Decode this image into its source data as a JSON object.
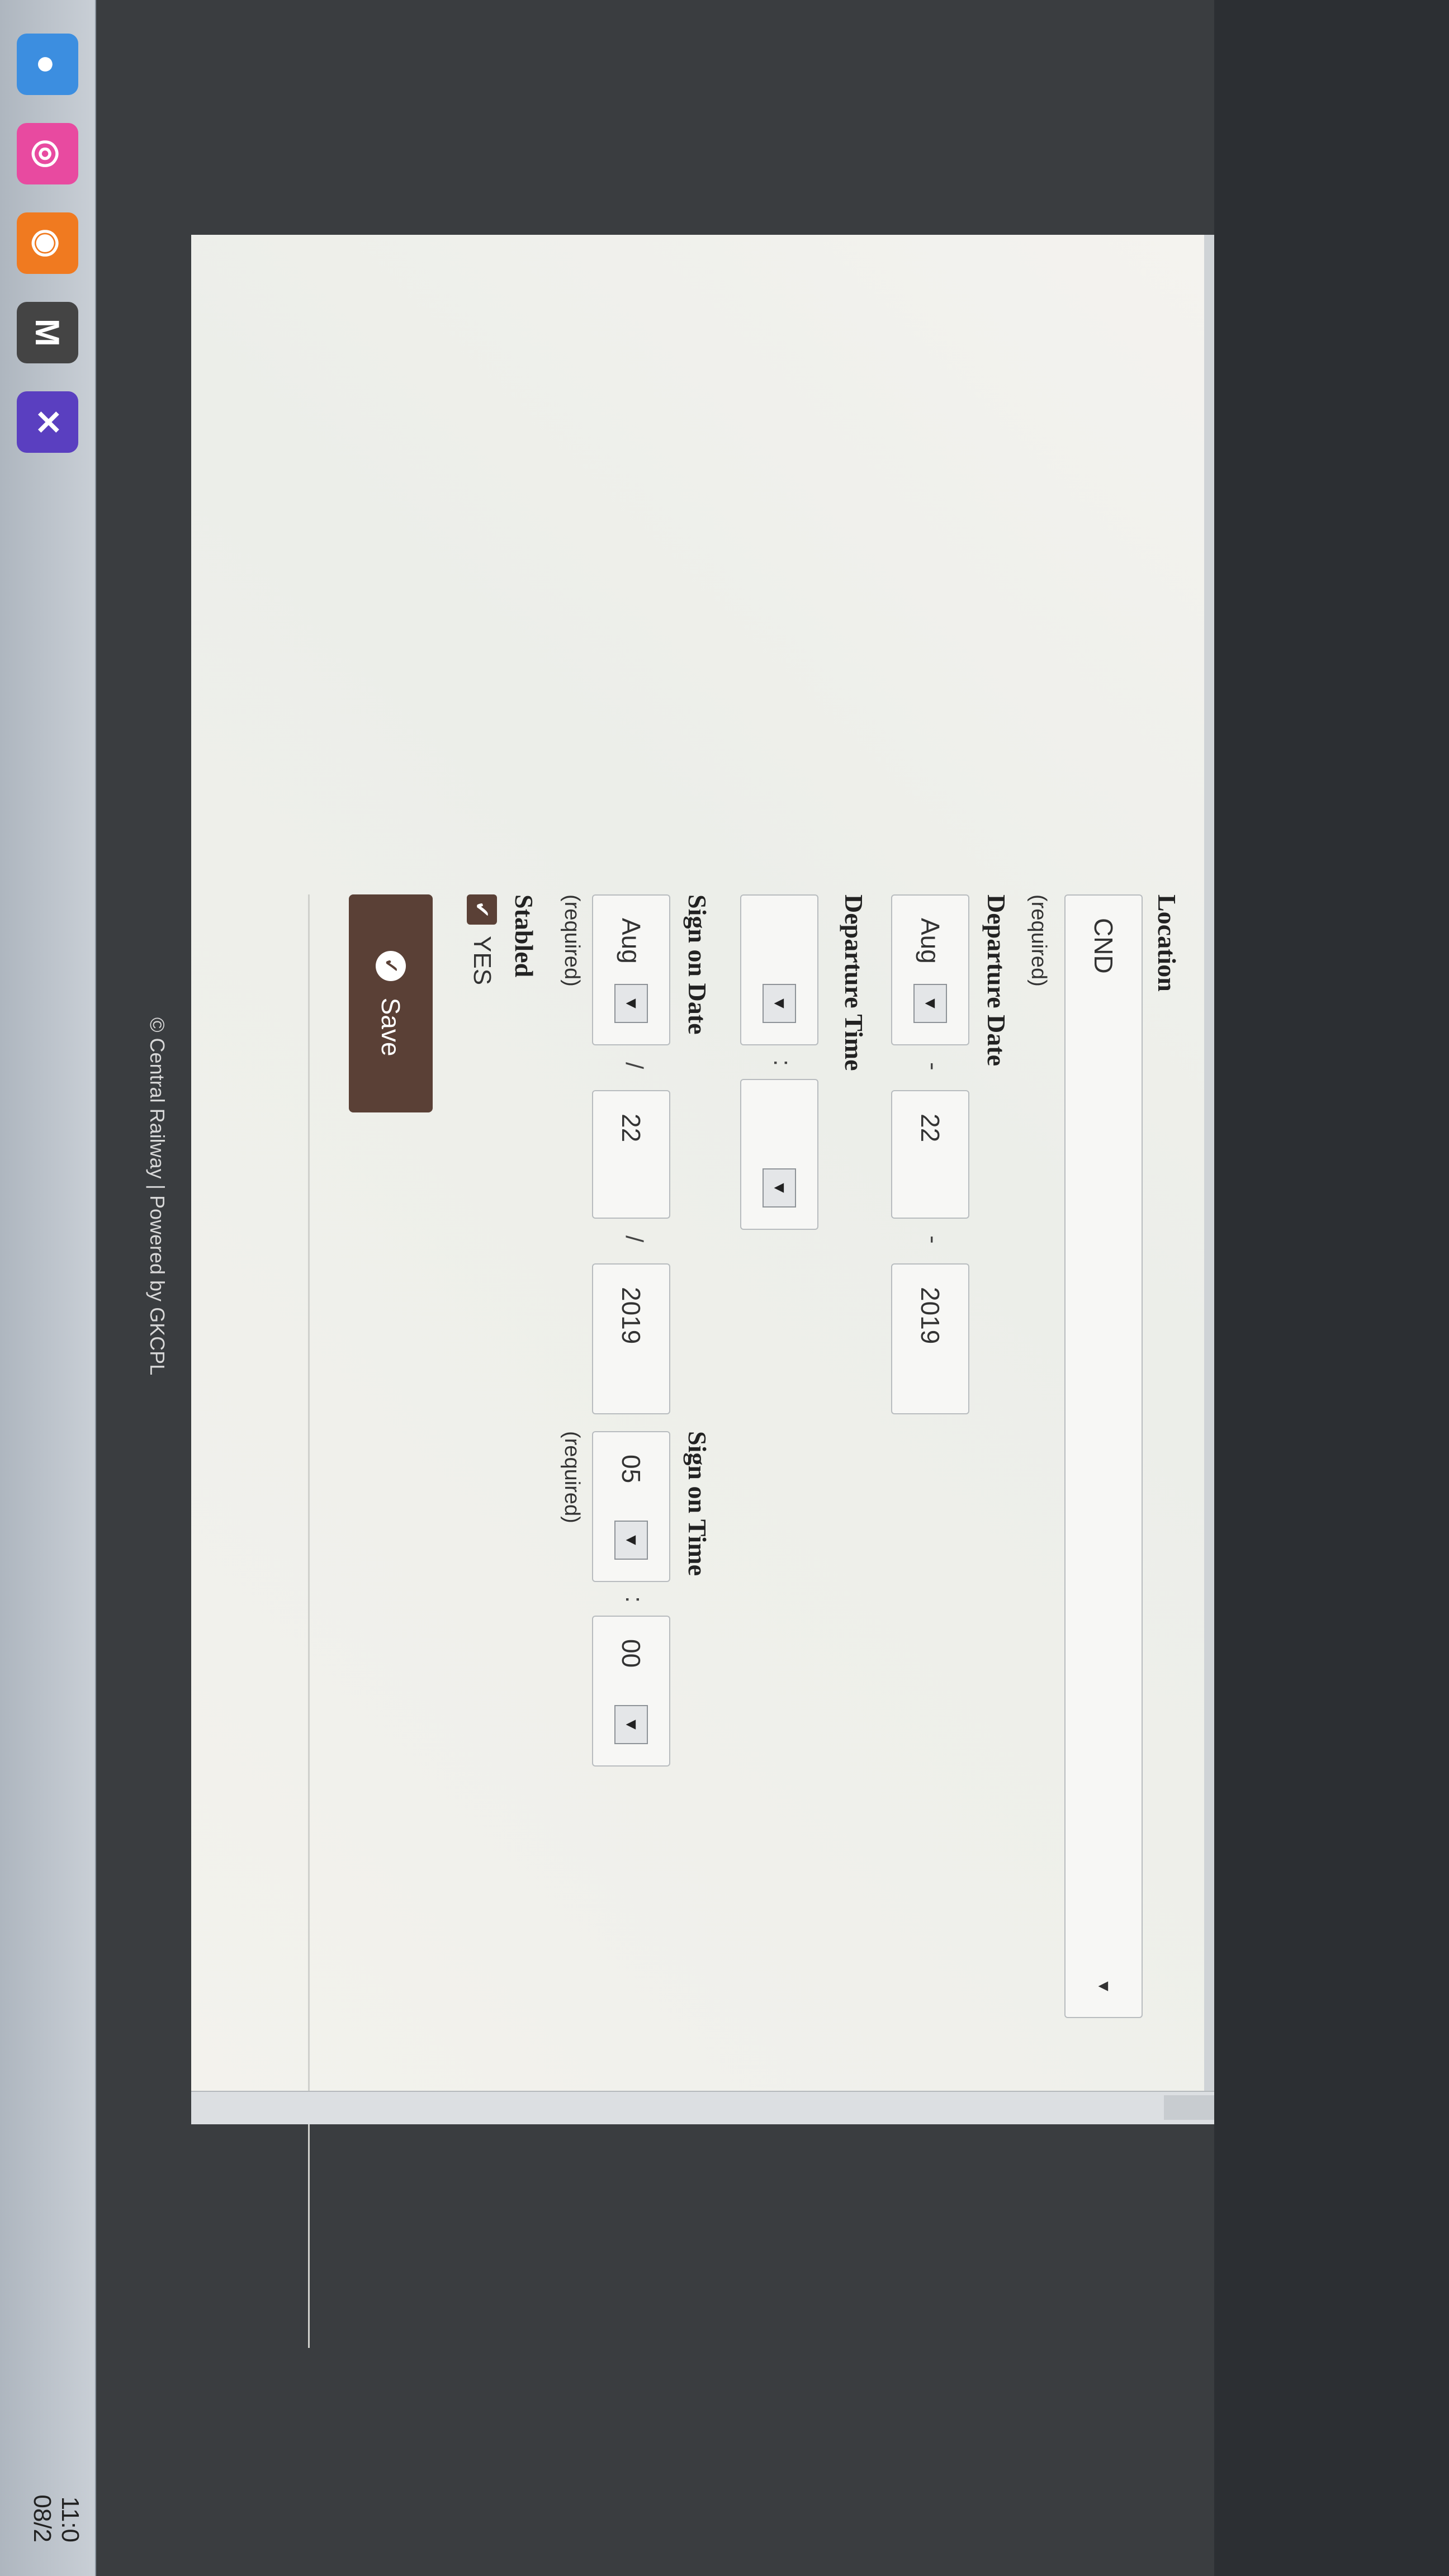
{
  "form": {
    "location_label": "Location",
    "location_value": "CND",
    "location_required": "(required)",
    "departure_date_label": "Departure Date",
    "departure_month": "Aug",
    "departure_day": "22",
    "departure_year": "2019",
    "departure_time_label": "Departure Time",
    "departure_hour": "",
    "departure_minute": "",
    "sign_on_date_label": "Sign on Date",
    "sign_on_month": "Aug",
    "sign_on_day": "22",
    "sign_on_year": "2019",
    "sign_on_required": "(required)",
    "sign_on_time_label": "Sign on Time",
    "sign_on_hour": "05",
    "sign_on_minute": "00",
    "sign_on_time_required": "(required)",
    "stabled_label": "Stabled",
    "stabled_option": "YES",
    "save_label": "Save",
    "date_sep": "-",
    "slash_sep": "/",
    "time_sep": ":"
  },
  "footer": {
    "text": "© Central Railway | Powered by GKCPL"
  },
  "tray": {
    "time": "11:0",
    "date": "08/2"
  },
  "colors": {
    "accent": "#5a4036"
  }
}
